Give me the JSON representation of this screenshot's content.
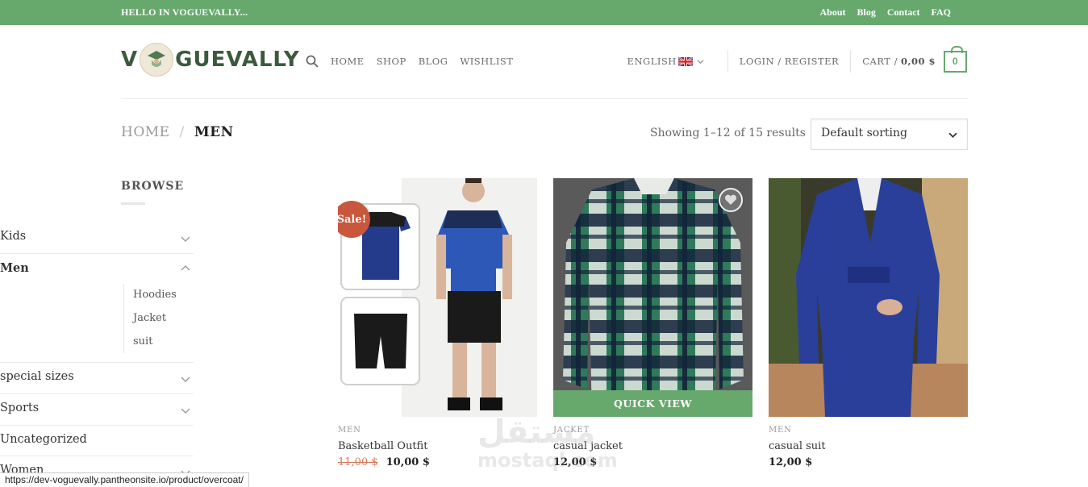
{
  "topbar": {
    "hello": "HELLO IN VOGUEVALLY...",
    "links": [
      "About",
      "Blog",
      "Contact",
      "FAQ"
    ]
  },
  "header": {
    "logo_left": "V",
    "logo_right": "GUEVALLY",
    "nav": [
      "HOME",
      "SHOP",
      "BLOG",
      "WISHLIST"
    ],
    "language": "ENGLISH",
    "login": "LOGIN / REGISTER",
    "cart_label": "CART /",
    "cart_amount": "0,00 $",
    "cart_count": "0"
  },
  "breadcrumb": {
    "home": "HOME",
    "separator": "/",
    "current": "MEN"
  },
  "results": {
    "showing": "Showing 1–12 of 15 results",
    "sort_selected": "Default sorting"
  },
  "sidebar": {
    "title": "BROWSE",
    "categories": [
      {
        "label": "Kids",
        "expanded": false
      },
      {
        "label": "Men",
        "expanded": true,
        "children": [
          "Hoodies",
          "Jacket",
          "suit"
        ]
      },
      {
        "label": "special sizes",
        "expanded": false
      },
      {
        "label": "Sports",
        "expanded": false
      },
      {
        "label": "Uncategorized",
        "expanded": false
      },
      {
        "label": "Women",
        "expanded": false
      }
    ]
  },
  "products": [
    {
      "category": "MEN",
      "name": "Basketball Outfit",
      "old_price": "11,00 $",
      "price": "10,00 $",
      "badge": "Sale!"
    },
    {
      "category": "JACKET",
      "name": "casual jacket",
      "price": "12,00 $",
      "quick_view": "QUICK VIEW"
    },
    {
      "category": "MEN",
      "name": "casual suit",
      "price": "12,00 $"
    }
  ],
  "status_url": "https://dev-voguevally.pantheonsite.io/product/overcoat/",
  "watermark": {
    "arabic": "مستقل",
    "latin": "mostaql.com"
  },
  "colors": {
    "accent": "#67a86c",
    "sale": "#c8573d",
    "logo": "#3b5a3d"
  }
}
